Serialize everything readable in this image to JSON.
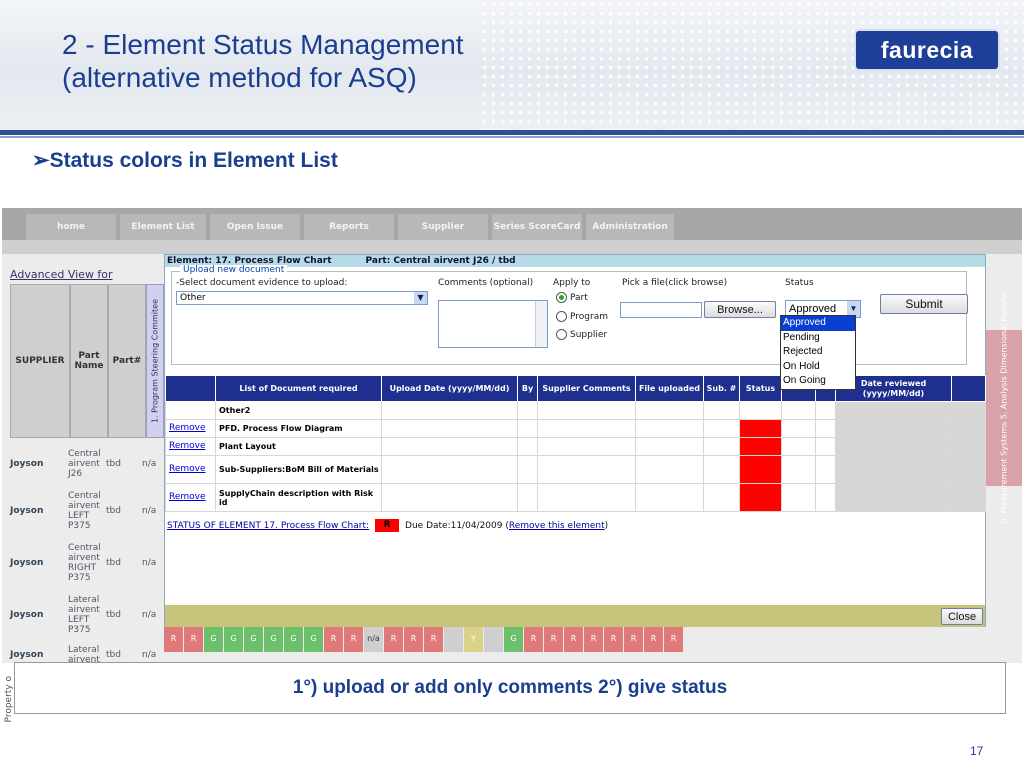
{
  "slide": {
    "title_line1": "2 - Element Status Management",
    "title_line2": "(alternative method for ASQ)",
    "logo_text": "faurecia",
    "bullet_marker": "➢",
    "bullet_text": "Status colors in Element List",
    "caption": "1°) upload or add only comments 2°) give status",
    "page_number": "17",
    "footer_vertical": "Property o"
  },
  "app": {
    "nav_tabs": [
      "home",
      "Element List",
      "Open Issue",
      "Reports",
      "Supplier",
      "Series ScoreCard",
      "Administration"
    ],
    "advanced_view": "Advanced View for",
    "grid_headers": [
      "SUPPLIER",
      "Part Name",
      "Part#"
    ],
    "vertical_header_left": "1. Program Steering Commitee",
    "vertical_header_right": "0. Measurement Systems   5. Analysis Dimensional Results",
    "rows": [
      {
        "supplier": "Joyson",
        "part": "Central airvent J26",
        "partno": "tbd",
        "na": "n/a"
      },
      {
        "supplier": "Joyson",
        "part": "Central airvent LEFT P375",
        "partno": "tbd",
        "na": "n/a"
      },
      {
        "supplier": "Joyson",
        "part": "Central airvent RIGHT P375",
        "partno": "tbd",
        "na": "n/a"
      },
      {
        "supplier": "Joyson",
        "part": "Lateral airvent LEFT P375",
        "partno": "tbd",
        "na": "n/a"
      },
      {
        "supplier": "Joyson",
        "part": "Lateral airvent",
        "partno": "tbd",
        "na": "n/a"
      }
    ],
    "status_cells": [
      "R",
      "R",
      "G",
      "G",
      "G",
      "G",
      "G",
      "G",
      "R",
      "R",
      "n/a",
      "R",
      "R",
      "R",
      "",
      "Y",
      "",
      "G",
      "R",
      "R",
      "R",
      "R",
      "R",
      "R",
      "R",
      "R"
    ],
    "colors": {
      "red": "#e07a7a",
      "green": "#6cc06c",
      "yellow": "#d8d28a",
      "grey": "#cfcfcf",
      "header_blue": "#1e2f8e"
    }
  },
  "modal": {
    "title_element": "Element: 17. Process Flow Chart",
    "title_part": "Part: Central airvent J26 / tbd",
    "legend": "Upload new document",
    "select_label": "-Select document evidence to upload:",
    "select_value": "Other",
    "comments_label": "Comments (optional)",
    "apply_label": "Apply to",
    "apply_options": [
      "Part",
      "Program",
      "Supplier"
    ],
    "apply_selected": "Part",
    "file_label": "Pick a file(click browse)",
    "browse_button": "Browse...",
    "status_label": "Status",
    "status_value": "Approved",
    "status_options": [
      "Approved",
      "Pending",
      "Rejected",
      "On Hold",
      "On Going"
    ],
    "submit_button": "Submit",
    "table_headers": [
      "",
      "List of Document required",
      "Upload Date (yyyy/MM/dd)",
      "By",
      "Supplier Comments",
      "File uploaded",
      "Sub. #",
      "Status",
      "",
      "",
      "Date reviewed (yyyy/MM/dd)",
      ""
    ],
    "docs": [
      {
        "action": "",
        "name": "Other2",
        "red": false
      },
      {
        "action": "Remove",
        "name": "PFD. Process Flow Diagram",
        "red": true
      },
      {
        "action": "Remove",
        "name": "Plant Layout",
        "red": true
      },
      {
        "action": "Remove",
        "name": "Sub-Suppliers:BoM Bill of Materials",
        "red": true
      },
      {
        "action": "Remove",
        "name": "SupplyChain description with Risk id",
        "red": true
      }
    ],
    "status_of_element": "STATUS OF ELEMENT 17. Process Flow Chart:",
    "status_code": "R",
    "due_date": "Due Date:11/04/2009 (",
    "remove_element": "Remove this element",
    "close_paren": ")",
    "close_button": "Close"
  }
}
